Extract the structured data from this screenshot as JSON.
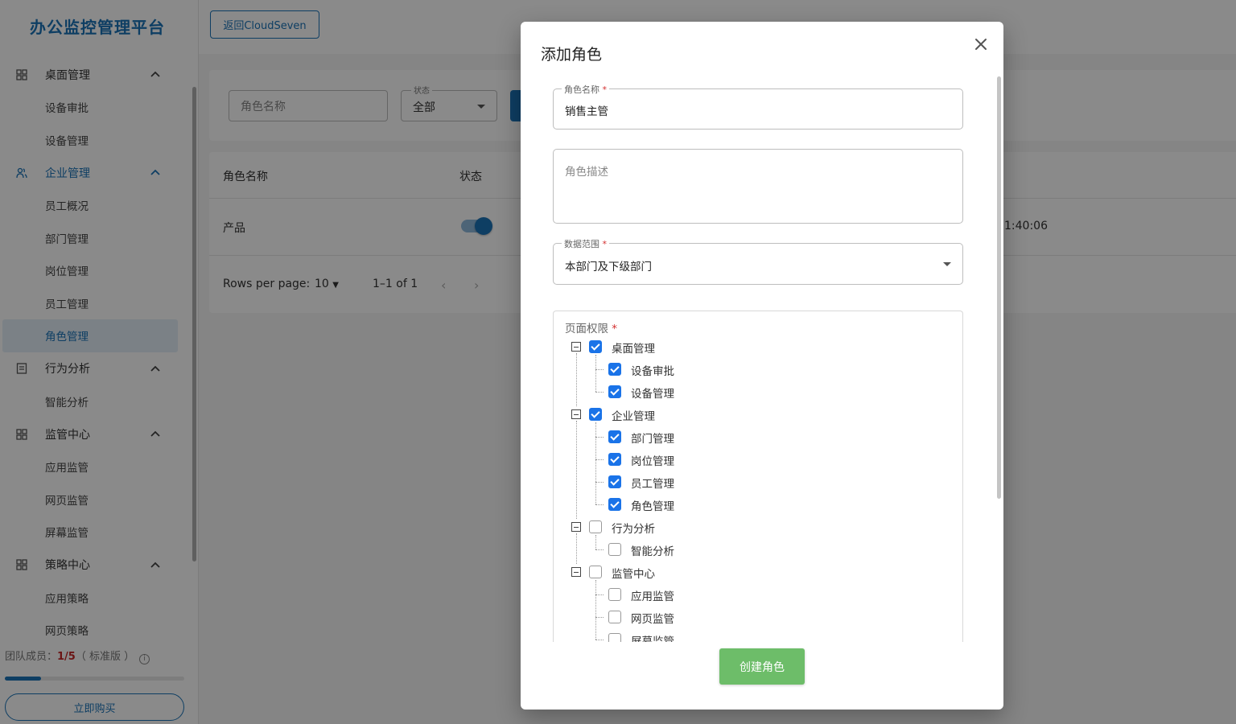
{
  "app": {
    "title": "办公监控管理平台",
    "back_label": "返回CloudSeven"
  },
  "sidebar": {
    "groups": [
      {
        "label": "桌面管理",
        "icon": "grid-icon",
        "items": [
          "设备审批",
          "设备管理"
        ]
      },
      {
        "label": "企业管理",
        "icon": "users-icon",
        "items": [
          "员工概况",
          "部门管理",
          "岗位管理",
          "员工管理",
          "角色管理"
        ]
      },
      {
        "label": "行为分析",
        "icon": "chart-icon",
        "items": [
          "智能分析"
        ]
      },
      {
        "label": "监管中心",
        "icon": "grid-icon",
        "items": [
          "应用监管",
          "网页监管",
          "屏幕监管"
        ]
      },
      {
        "label": "策略中心",
        "icon": "grid-icon",
        "items": [
          "应用策略",
          "网页策略"
        ]
      }
    ],
    "active_item": "角色管理",
    "team_label": "团队成员：",
    "team_count": "1/5",
    "team_edition": "（ 标准版 ）",
    "team_progress": 0.2,
    "buy_label": "立即购买"
  },
  "filters": {
    "name_placeholder": "角色名称",
    "status_label": "状态",
    "status_value": "全部"
  },
  "table": {
    "columns": [
      "角色名称",
      "状态"
    ],
    "rows": [
      {
        "name": "产品",
        "enabled": true,
        "time_fragment": "1:40:06"
      }
    ],
    "rows_per_page_label": "Rows per page:",
    "rows_per_page_value": "10",
    "range": "1–1 of 1"
  },
  "dialog": {
    "title": "添加角色",
    "name_label": "角色名称",
    "name_value": "销售主管",
    "desc_placeholder": "角色描述",
    "scope_label": "数据范围",
    "scope_value": "本部门及下级部门",
    "perm_label": "页面权限",
    "required_mark": "*",
    "tree": [
      {
        "label": "桌面管理",
        "checked": true,
        "children": [
          {
            "label": "设备审批",
            "checked": true
          },
          {
            "label": "设备管理",
            "checked": true
          }
        ]
      },
      {
        "label": "企业管理",
        "checked": true,
        "children": [
          {
            "label": "部门管理",
            "checked": true
          },
          {
            "label": "岗位管理",
            "checked": true
          },
          {
            "label": "员工管理",
            "checked": true
          },
          {
            "label": "角色管理",
            "checked": true
          }
        ]
      },
      {
        "label": "行为分析",
        "checked": false,
        "children": [
          {
            "label": "智能分析",
            "checked": false
          }
        ]
      },
      {
        "label": "监管中心",
        "checked": false,
        "children": [
          {
            "label": "应用监管",
            "checked": false
          },
          {
            "label": "网页监管",
            "checked": false
          },
          {
            "label": "屏幕监管",
            "checked": false
          }
        ]
      }
    ],
    "create_label": "创建角色"
  }
}
